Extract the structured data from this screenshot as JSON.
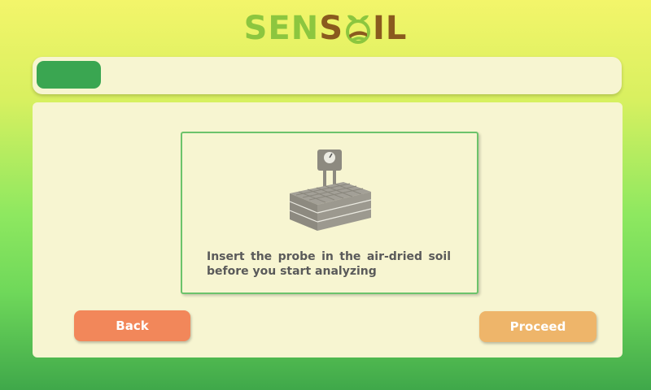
{
  "logo": {
    "part1": "SEN",
    "part2": "S",
    "part3": "IL"
  },
  "progress": {
    "fraction": 0.11
  },
  "step": {
    "instruction": "Insert the probe in the air-dried soil before you start analyzing",
    "illustration_icon": "soil-probe-icon"
  },
  "buttons": {
    "back_label": "Back",
    "proceed_label": "Proceed"
  },
  "colors": {
    "progress_fill": "#3aa651",
    "back_button": "#f2875a",
    "proceed_button": "#eeb56a",
    "panel": "#f7f5d1"
  }
}
